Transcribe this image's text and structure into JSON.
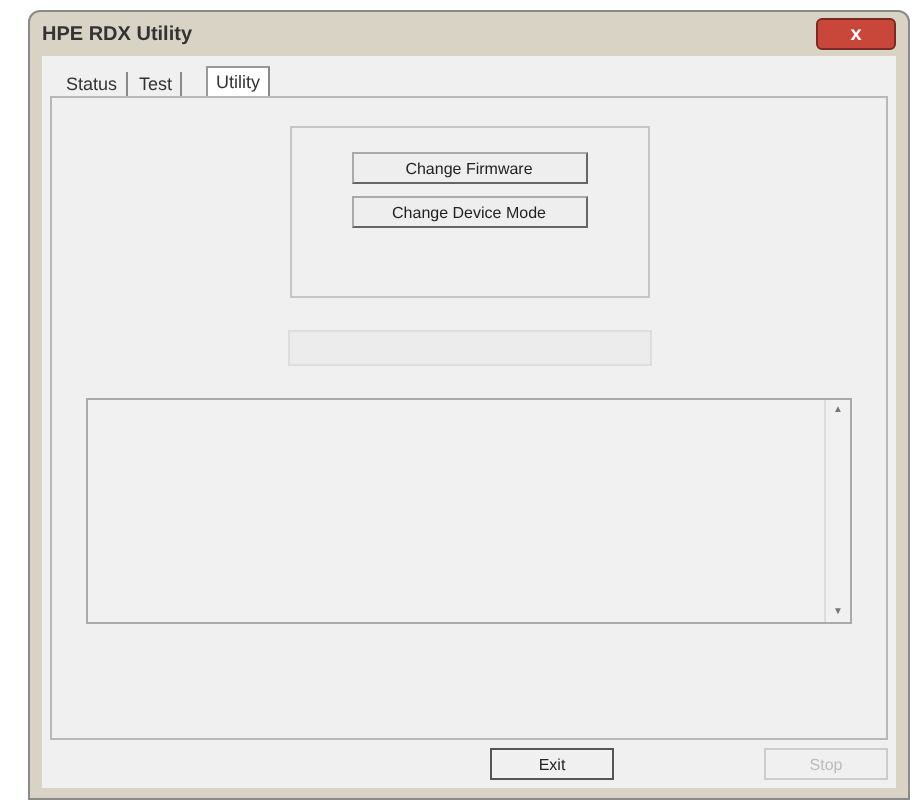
{
  "window": {
    "title": "HPE RDX Utility",
    "close": "x"
  },
  "tabs": [
    {
      "label": "Status",
      "selected": false
    },
    {
      "label": "Test",
      "selected": false
    },
    {
      "label": "Utility",
      "selected": true
    }
  ],
  "utility": {
    "buttons": [
      "Change Firmware",
      "Change Device Mode"
    ],
    "log": {
      "scroll_up": "▲",
      "scroll_down": "▼"
    }
  },
  "footer": [
    {
      "label": "Exit",
      "disabled": false
    },
    {
      "label": "Stop",
      "disabled": true
    }
  ]
}
